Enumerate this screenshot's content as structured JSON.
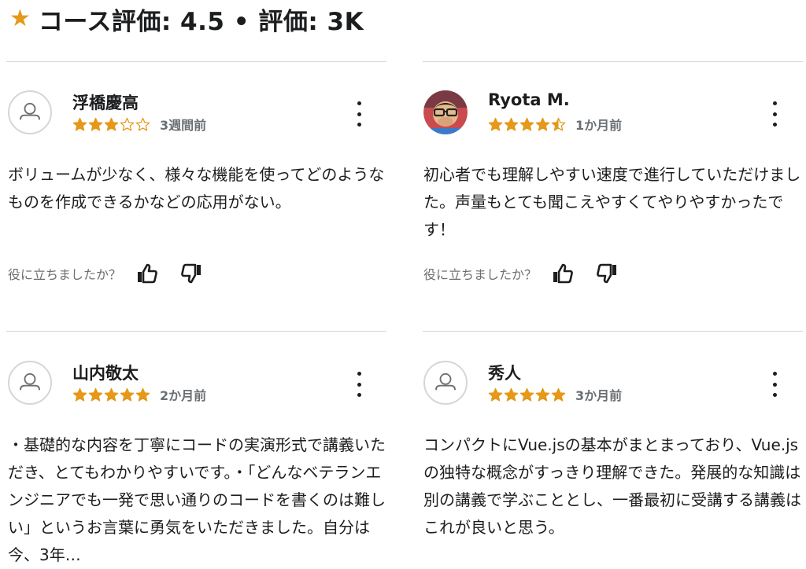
{
  "header": {
    "star_icon": "★",
    "title": "コース評価: 4.5 • 評価: 3K",
    "accent_color": "#e59819"
  },
  "helpful_question": "役に立ちましたか？",
  "reviews": [
    {
      "name": "浮橋慶高",
      "avatar": "default-user-icon",
      "rating": 3,
      "time": "3週間前",
      "text": "ボリュームが少なく、様々な機能を使ってどのようなものを作成できるかなどの応用がない。"
    },
    {
      "name": "Ryota M.",
      "avatar": "user-photo",
      "rating": 4.5,
      "time": "1か月前",
      "text": "初心者でも理解しやすい速度で進行していただけました。声量もとても聞こえやすくてやりやすかったです！"
    },
    {
      "name": "山内敬太",
      "avatar": "default-user-icon",
      "rating": 5,
      "time": "2か月前",
      "text": "・基礎的な内容を丁寧にコードの実演形式で講義いただき、とてもわかりやすいです。・「どんなベテランエンジニアでも一発で思い通りのコードを書くのは難しい」というお言葉に勇気をいただきました。自分は今、3年…"
    },
    {
      "name": "秀人",
      "avatar": "default-user-icon",
      "rating": 5,
      "time": "3か月前",
      "text": "コンパクトにVue.jsの基本がまとまっており、Vue.jsの独特な概念がすっきり理解できた。発展的な知識は別の講義で学ぶこととし、一番最初に受講する講義はこれが良いと思う。"
    }
  ]
}
